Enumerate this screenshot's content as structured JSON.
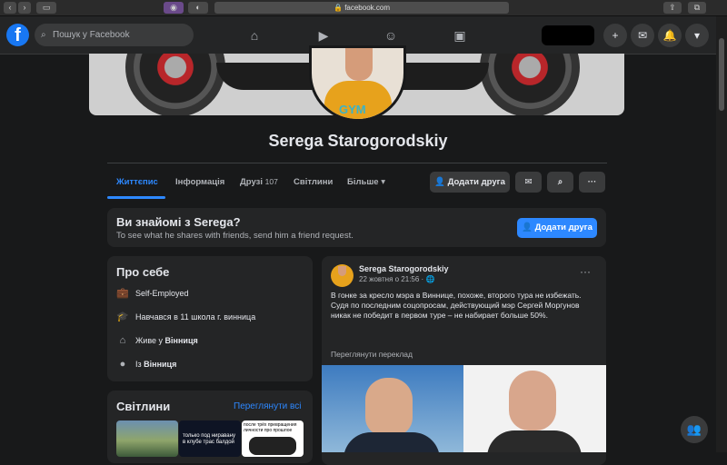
{
  "browser": {
    "url": "facebook.com"
  },
  "header": {
    "search_placeholder": "Пошук у Facebook"
  },
  "profile": {
    "name": "Serega Starogorodskiy",
    "shirt_text": "GYM"
  },
  "tabs": [
    {
      "label": "Життєпис"
    },
    {
      "label": "Інформація"
    },
    {
      "label": "Друзі",
      "count": "107"
    },
    {
      "label": "Світлини"
    },
    {
      "label": "Більше"
    }
  ],
  "actions": {
    "add_friend": "Додати друга"
  },
  "know_card": {
    "title": "Ви знайомі з Serega?",
    "subtitle": "To see what he shares with friends, send him a friend request.",
    "button": "Додати друга"
  },
  "intro": {
    "title": "Про себе",
    "items": [
      {
        "icon": "briefcase-icon",
        "text": "Self-Employed"
      },
      {
        "icon": "graduation-cap-icon",
        "text": "Навчався в 11 школа г. винница"
      },
      {
        "icon": "home-icon",
        "text_pre": "Живе у ",
        "text_bold": "Вінниця"
      },
      {
        "icon": "location-pin-icon",
        "text_pre": "Із ",
        "text_bold": "Вінниця"
      }
    ]
  },
  "photos": {
    "title": "Світлини",
    "see_all": "Переглянути всі",
    "thumb2_caption": "только под ниравану в клубе трас балдой",
    "thumb3_caption": "после трёх превращения личности про прошлое"
  },
  "post": {
    "author": "Serega Starogorodskiy",
    "date": "22 жовтня о 21:56",
    "lines": [
      "В гонке за кресло мэра в Виннице, похоже, второго тура не избежать.",
      "Судя по последним соцопросам, действующий мэр Сергей Моргунов никак не победит в первом туре – не набирает больше 50%."
    ],
    "translate": "Переглянути переклад"
  },
  "colors": {
    "accent": "#2d88ff",
    "bg": "#18191a",
    "card": "#242526"
  }
}
